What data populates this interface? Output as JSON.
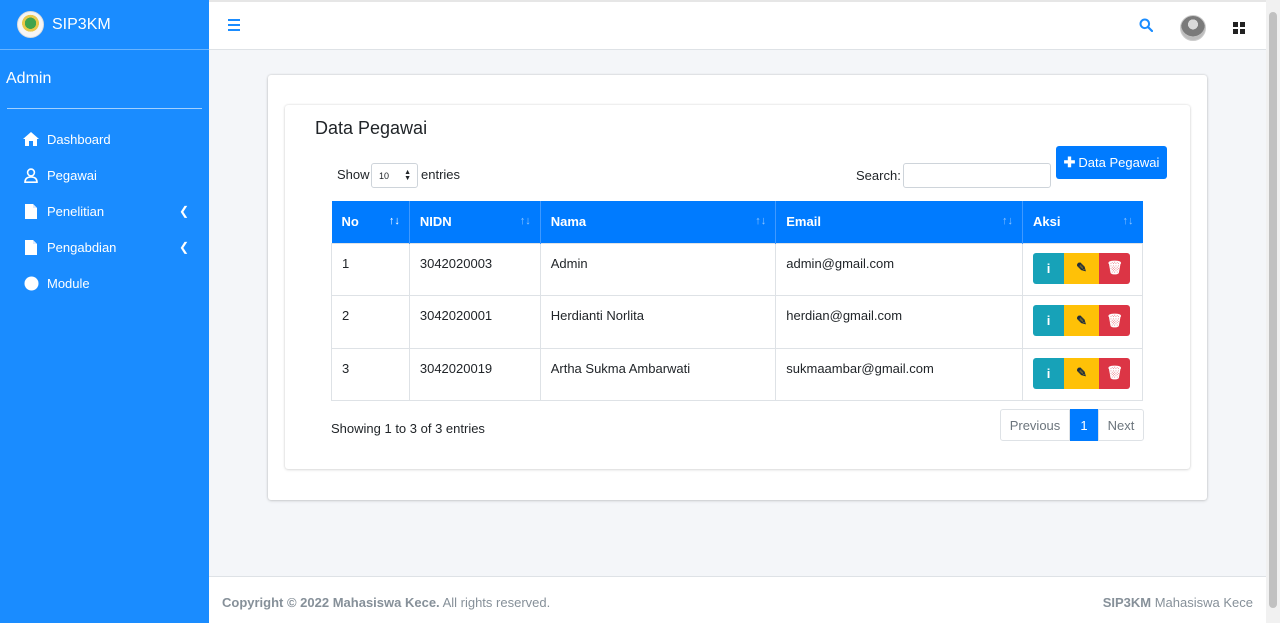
{
  "brand": {
    "name": "SIP3KM"
  },
  "user": {
    "name": "Admin"
  },
  "sidebar": {
    "items": [
      {
        "label": "Dashboard",
        "icon": "home-icon",
        "has_children": false
      },
      {
        "label": "Pegawai",
        "icon": "user-icon",
        "has_children": false
      },
      {
        "label": "Penelitian",
        "icon": "file-icon",
        "has_children": true
      },
      {
        "label": "Pengabdian",
        "icon": "file-icon",
        "has_children": true
      },
      {
        "label": "Module",
        "icon": "circle-icon",
        "has_children": false
      }
    ]
  },
  "card": {
    "title": "Data Pegawai",
    "add_button": "Data Pegawai"
  },
  "datatable": {
    "show_label": "Show",
    "page_size": "10",
    "entries_label": "entries",
    "search_label": "Search:",
    "search_value": "",
    "columns": [
      "No",
      "NIDN",
      "Nama",
      "Email",
      "Aksi"
    ],
    "rows": [
      {
        "no": "1",
        "nidn": "3042020003",
        "nama": "Admin",
        "email": "admin@gmail.com"
      },
      {
        "no": "2",
        "nidn": "3042020001",
        "nama": "Herdianti Norlita",
        "email": "herdian@gmail.com"
      },
      {
        "no": "3",
        "nidn": "3042020019",
        "nama": "Artha Sukma Ambarwati",
        "email": "sukmaambar@gmail.com"
      }
    ],
    "info": "Showing 1 to 3 of 3 entries",
    "pagination": {
      "prev": "Previous",
      "current": "1",
      "next": "Next"
    }
  },
  "footer": {
    "copyright_bold": "Copyright © 2022 Mahasiswa Kece.",
    "copyright_rest": " All rights reserved.",
    "right_bold": "SIP3KM",
    "right_rest": " Mahasiswa Kece"
  },
  "colors": {
    "sidebar": "#1a8cff",
    "primary": "#007bff",
    "info": "#17a2b8",
    "warning": "#ffc107",
    "danger": "#dc3545"
  }
}
